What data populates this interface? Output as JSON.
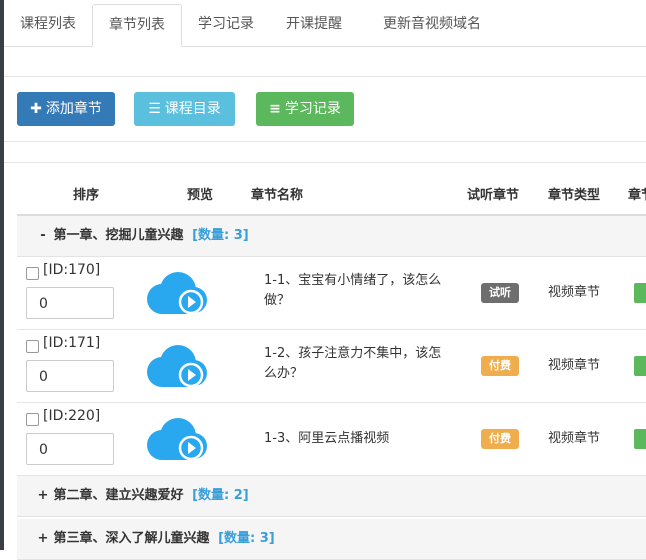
{
  "tabs": [
    "课程列表",
    "章节列表",
    "学习记录",
    "开课提醒",
    "更新音视频域名"
  ],
  "actions": {
    "add_chapter": "添加章节",
    "course_catalog": "课程目录",
    "study_record": "学习记录"
  },
  "table": {
    "headers": [
      "排序",
      "预览",
      "章节名称",
      "试听章节",
      "章节类型",
      "章节"
    ]
  },
  "chapters": [
    {
      "sign": "-",
      "title": "第一章、挖掘儿童兴趣",
      "count": "[数量: 3]"
    },
    {
      "sign": "+",
      "title": "第二章、建立兴趣爱好",
      "count": "[数量: 2]"
    },
    {
      "sign": "+",
      "title": "第三章、深入了解儿童兴趣",
      "count": "[数量: 3]"
    }
  ],
  "lessons": [
    {
      "id": "[ID:170]",
      "sort": "0",
      "name": "1-1、宝宝有小情绪了，该怎么做？",
      "trial": "试听",
      "type": "视频章节"
    },
    {
      "id": "[ID:171]",
      "sort": "0",
      "name": "1-2、孩子注意力不集中，该怎么办？",
      "trial": "付费",
      "type": "视频章节"
    },
    {
      "id": "[ID:220]",
      "sort": "0",
      "name": "1-3、阿里云点播视频",
      "trial": "付费",
      "type": "视频章节"
    }
  ],
  "colors": {
    "primary": "#337ab7",
    "info": "#5bc0de",
    "success": "#5cb85c",
    "warning": "#f0ad4e",
    "cloud": "#29a8ef"
  }
}
